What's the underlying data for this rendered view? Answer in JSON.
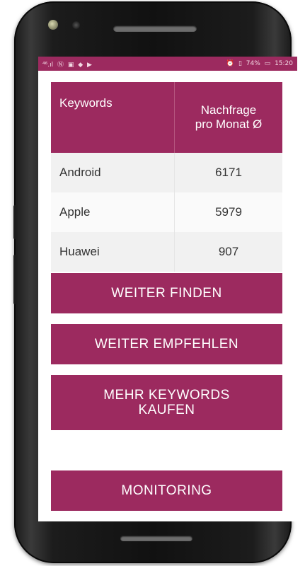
{
  "status_bar": {
    "left_icons": [
      "signal-icon",
      "nfc-icon",
      "cast-icon",
      "shield-icon",
      "play-icon"
    ],
    "left_text": "⁴⁶.ıl",
    "alarm_icon": "alarm-icon",
    "battery_percent": "74%",
    "time": "15:20"
  },
  "table": {
    "header_keyword": "Keywords",
    "header_demand_line1": "Nachfrage",
    "header_demand_line2": "pro Monat Ø",
    "rows": [
      {
        "keyword": "Android",
        "demand": "6171"
      },
      {
        "keyword": "Apple",
        "demand": "5979"
      },
      {
        "keyword": "Huawei",
        "demand": "907"
      }
    ]
  },
  "buttons": {
    "find_more": "WEITER FINDEN",
    "recommend": "WEITER EMPFEHLEN",
    "buy_keywords_line1": "MEHR KEYWORDS",
    "buy_keywords_line2": "KAUFEN",
    "monitoring": "MONITORING"
  },
  "colors": {
    "accent": "#9c2a5f",
    "row_odd": "#f1f1f1",
    "row_even": "#fafafa"
  }
}
